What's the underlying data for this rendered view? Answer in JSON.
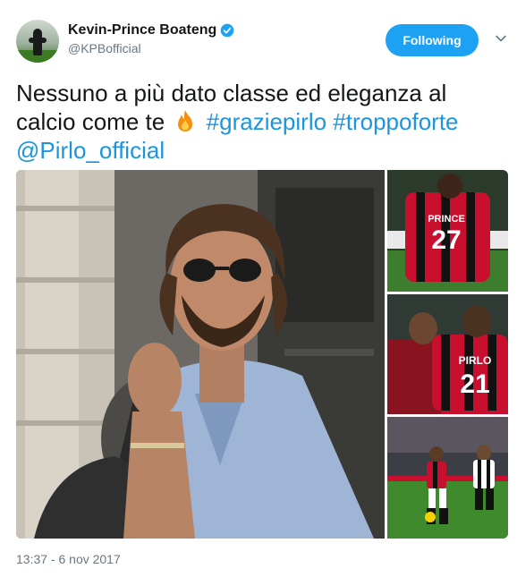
{
  "tweet": {
    "author": {
      "display_name": "Kevin-Prince Boateng",
      "handle": "@KPBofficial",
      "verified": true
    },
    "follow_button_label": "Following",
    "text_plain": "Nessuno a più dato classe ed eleganza al calcio come te",
    "emoji": "fire-emoji",
    "hashtags": [
      "#graziepirlo",
      "#troppoforte"
    ],
    "mention": "@Pirlo_official",
    "timestamp": "13:37 - 6 nov 2017",
    "media": {
      "count": 4,
      "jersey_names": [
        "PRINCE",
        "PIRLO"
      ],
      "jersey_numbers": [
        "27",
        "21"
      ]
    }
  },
  "colors": {
    "link": "#1b95e0",
    "follow_button": "#1da1f2",
    "text": "#14171a",
    "muted": "#657786",
    "milan_red": "#c8102e"
  }
}
